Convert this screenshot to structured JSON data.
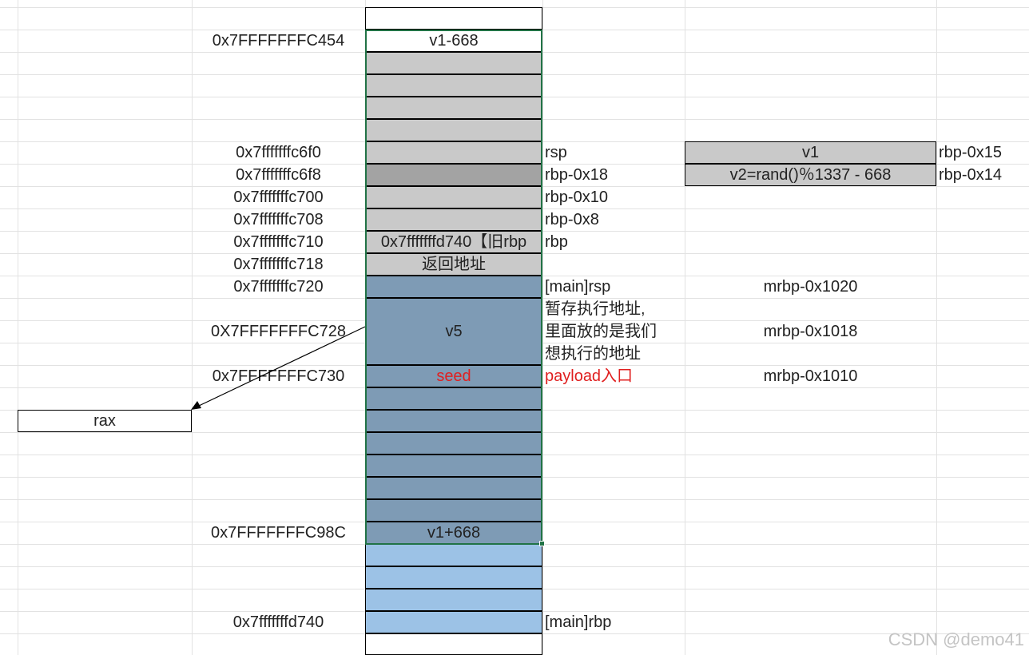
{
  "stack_labels": {
    "top": "v1-668",
    "old_rbp": "0x7fffffffd740【旧rbp",
    "return_addr": "返回地址",
    "v5": "v5",
    "seed": "seed",
    "bottom": "v1+668"
  },
  "addresses": {
    "c454": "0x7FFFFFFFC454",
    "c6f0": "0x7fffffffc6f0",
    "c6f8": "0x7fffffffc6f8",
    "c700": "0x7fffffffc700",
    "c708": "0x7fffffffc708",
    "c710": "0x7fffffffc710",
    "c718": "0x7fffffffc718",
    "c720": "0x7fffffffc720",
    "c728": "0X7FFFFFFFC728",
    "c730": "0x7FFFFFFFC730",
    "c98c": "0x7FFFFFFFC98C",
    "d740": "0x7fffffffd740"
  },
  "offsets": {
    "rsp": "rsp",
    "rbp_18": "rbp-0x18",
    "rbp_10": "rbp-0x10",
    "rbp_8": "rbp-0x8",
    "rbp": "rbp",
    "main_rsp": "[main]rsp",
    "note_lines": [
      "暂存执行地址,",
      "里面放的是我们",
      "想执行的地址"
    ],
    "payload": "payload入口",
    "main_rbp": "[main]rbp"
  },
  "variables": {
    "v1": "v1",
    "v1_offset": "rbp-0x15",
    "v2": "v2=rand()％1337 - 668",
    "v2_offset": "rbp-0x14"
  },
  "main_offsets": {
    "m1020": "mrbp-0x1020",
    "m1018": "mrbp-0x1018",
    "m1010": "mrbp-0x1010"
  },
  "rax_box": "rax",
  "watermark": "CSDN @demo41",
  "colors": {
    "gridline": "#e2e2e2",
    "light_grey_fill": "#c9c9c9",
    "dark_grey_fill": "#a3a3a3",
    "steel_blue_fill": "#7e9bb5",
    "sky_blue_fill": "#9cc2e6",
    "seed_text": "#e02020",
    "selection_border": "#217346"
  }
}
